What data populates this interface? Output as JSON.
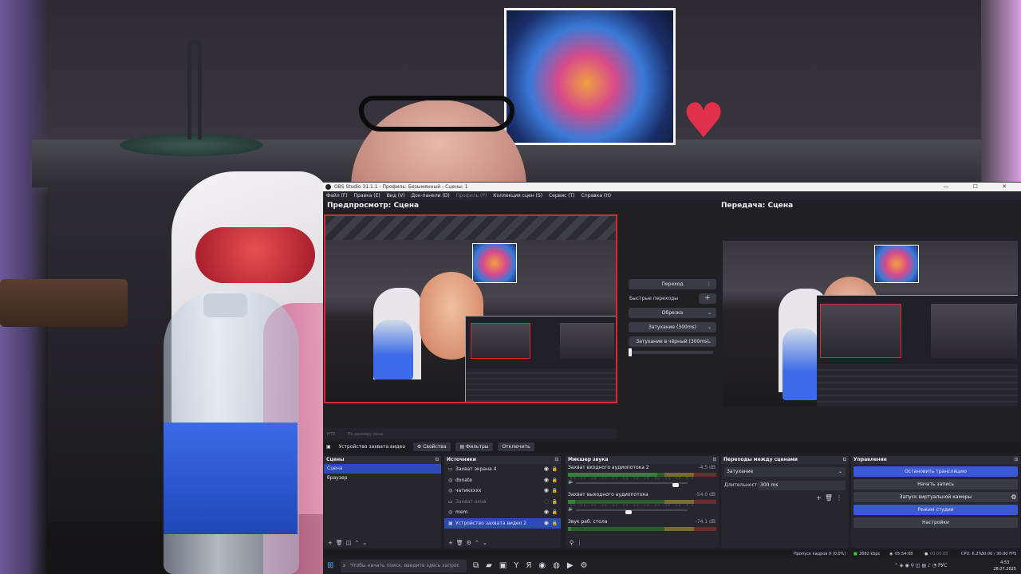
{
  "window": {
    "title": "OBS Studio 31.1.1 - Профиль: Безымянный - Сцены: 1",
    "controls": "— ☐ ✕"
  },
  "menu": [
    "Файл (F)",
    "Правка (E)",
    "Вид (V)",
    "Док-панели (D)",
    "Профиль (P)",
    "Коллекция сцен (S)",
    "Сервис (T)",
    "Справка (H)"
  ],
  "preview": {
    "title": "Предпросмотр: Сцена",
    "status_left": "HTR",
    "status_scale": "По размеру окна"
  },
  "program": {
    "title": "Передача: Сцена"
  },
  "transition_panel": {
    "transition_button": "Переход",
    "more_icon": "⋮",
    "quick_label": "Быстрые переходы",
    "add_icon": "+",
    "items": [
      "Обрезка",
      "Затухание (300ms)",
      "Затухание в чёрный (300ms)"
    ]
  },
  "source_toolbar": {
    "source_name": "Устройство захвата видео",
    "properties": "Свойства",
    "filters": "Фильтры",
    "deactivate": "Отключить"
  },
  "scenes": {
    "title": "Сцены",
    "items": [
      "Сцена",
      "браузер"
    ]
  },
  "sources": {
    "title": "Источники",
    "items": [
      {
        "name": "Захват экрана 4",
        "icon": "monitor-icon",
        "glyph": "▭"
      },
      {
        "name": "donate",
        "icon": "globe-icon",
        "glyph": "◎"
      },
      {
        "name": "чатикхххх",
        "icon": "globe-icon",
        "glyph": "◎"
      },
      {
        "name": "Захват окна",
        "icon": "window-icon",
        "glyph": "▭"
      },
      {
        "name": "mem",
        "icon": "globe-icon",
        "glyph": "◎"
      },
      {
        "name": "Устройство захвата видео 2",
        "icon": "camera-icon",
        "glyph": "▣"
      }
    ]
  },
  "mixer": {
    "title": "Микшер звука",
    "channels": [
      {
        "name": "Захват входного аудиопотока 2",
        "db": "-4.5 dB",
        "level": 0.6,
        "fader": 0.92
      },
      {
        "name": "Захват выходного аудиопотока",
        "db": "-54.0 dB",
        "level": 0.05,
        "fader": 0.5
      },
      {
        "name": "Звук раб. стола",
        "db": "-74.1 dB",
        "level": 0.02,
        "fader": 0.7
      }
    ],
    "ticks": "-60 -55 -50 -45 -40 -35 -30 -25 -20 -15 -10 -5 0"
  },
  "transitions_dock": {
    "title": "Переходы между сценами",
    "selected": "Затухание",
    "duration_label": "Длительность",
    "duration_value": "300 ms"
  },
  "controls": {
    "title": "Управление",
    "stop_stream": "Остановить трансляцию",
    "start_record": "Начать запись",
    "virtual_cam": "Запуск виртуальной камеры",
    "studio_mode": "Режим студии",
    "settings": "Настройки"
  },
  "status": {
    "dropped": "Пропуск кадров 0 (0,0%)",
    "bitrate": "2682 kbps",
    "stream_time": "05:54:08",
    "record_time": "00:00:00",
    "cpu": "CPU: 6.2%",
    "fps": "30.00 / 30.00 FPS"
  },
  "taskbar": {
    "search_placeholder": "Чтобы начать поиск, введите здесь запрос",
    "lang": "РУС",
    "time": "4:53",
    "date": "28.07.2025"
  },
  "colors": {
    "accent_blue": "#3a58d8",
    "preview_border": "#d42a3a",
    "dock_bg": "#26262c"
  }
}
